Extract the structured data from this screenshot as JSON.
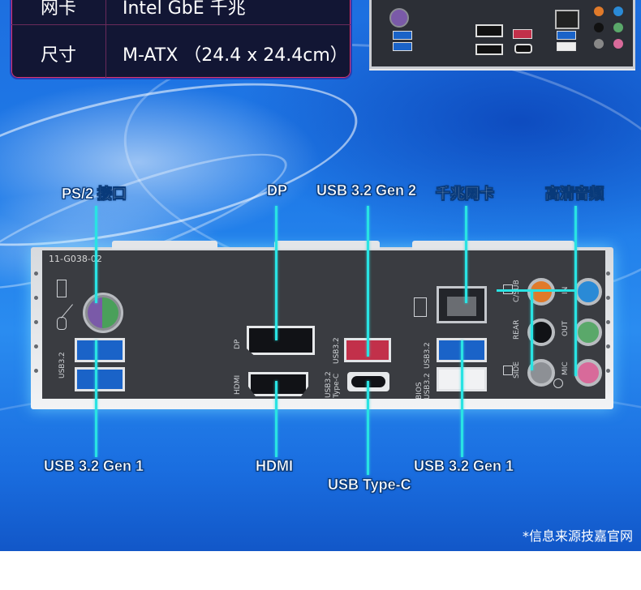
{
  "spec_table": {
    "rows": [
      {
        "key": "网卡",
        "value": "Intel  GbE 千兆"
      },
      {
        "key": "尺寸",
        "value": "M-ATX （24.4 x 24.4cm）"
      }
    ]
  },
  "panel": {
    "model_code": "11-G038-02",
    "port_text": {
      "usb32": "USB3.2",
      "dp": "DP",
      "hdmi": "HDMI",
      "usb32_typec": "USB3.2",
      "typec": "Type-C",
      "usb32_top": "USB3.2",
      "bios": "BIOS",
      "usb32_bios": "USB3.2",
      "usb32_right": "USB3.2",
      "csub": "C/SUB",
      "rear": "REAR",
      "side": "SIDE",
      "in": "IN",
      "out": "OUT",
      "mic": "MIC"
    }
  },
  "callouts": {
    "ps2": "PS/2 接口",
    "dp": "DP",
    "usb32gen2": "USB 3.2 Gen 2",
    "lan": "千兆网卡",
    "audio": "高清音频",
    "usb32gen1_left": "USB 3.2 Gen 1",
    "hdmi": "HDMI",
    "usb_typec": "USB Type-C",
    "usb32gen1_right": "USB 3.2 Gen 1"
  },
  "footnote": "*信息来源技嘉官网",
  "colors": {
    "callout_line": "#29e3e3",
    "background_blue": "#1f7be8",
    "panel_dark": "#3a3c41",
    "usb3_blue": "#1a63c8",
    "usb_gen2_red": "#c2304a",
    "audio_orange": "#e07a2a",
    "audio_blue": "#2a8ad6",
    "audio_green": "#5aa86a",
    "audio_pink": "#d86a9a",
    "ps2_purple": "#7a5aa8",
    "ps2_green": "#4aa05a"
  },
  "icons": [
    "keyboard-icon",
    "mouse-icon",
    "network-icon",
    "speaker-icon",
    "microphone-icon"
  ]
}
